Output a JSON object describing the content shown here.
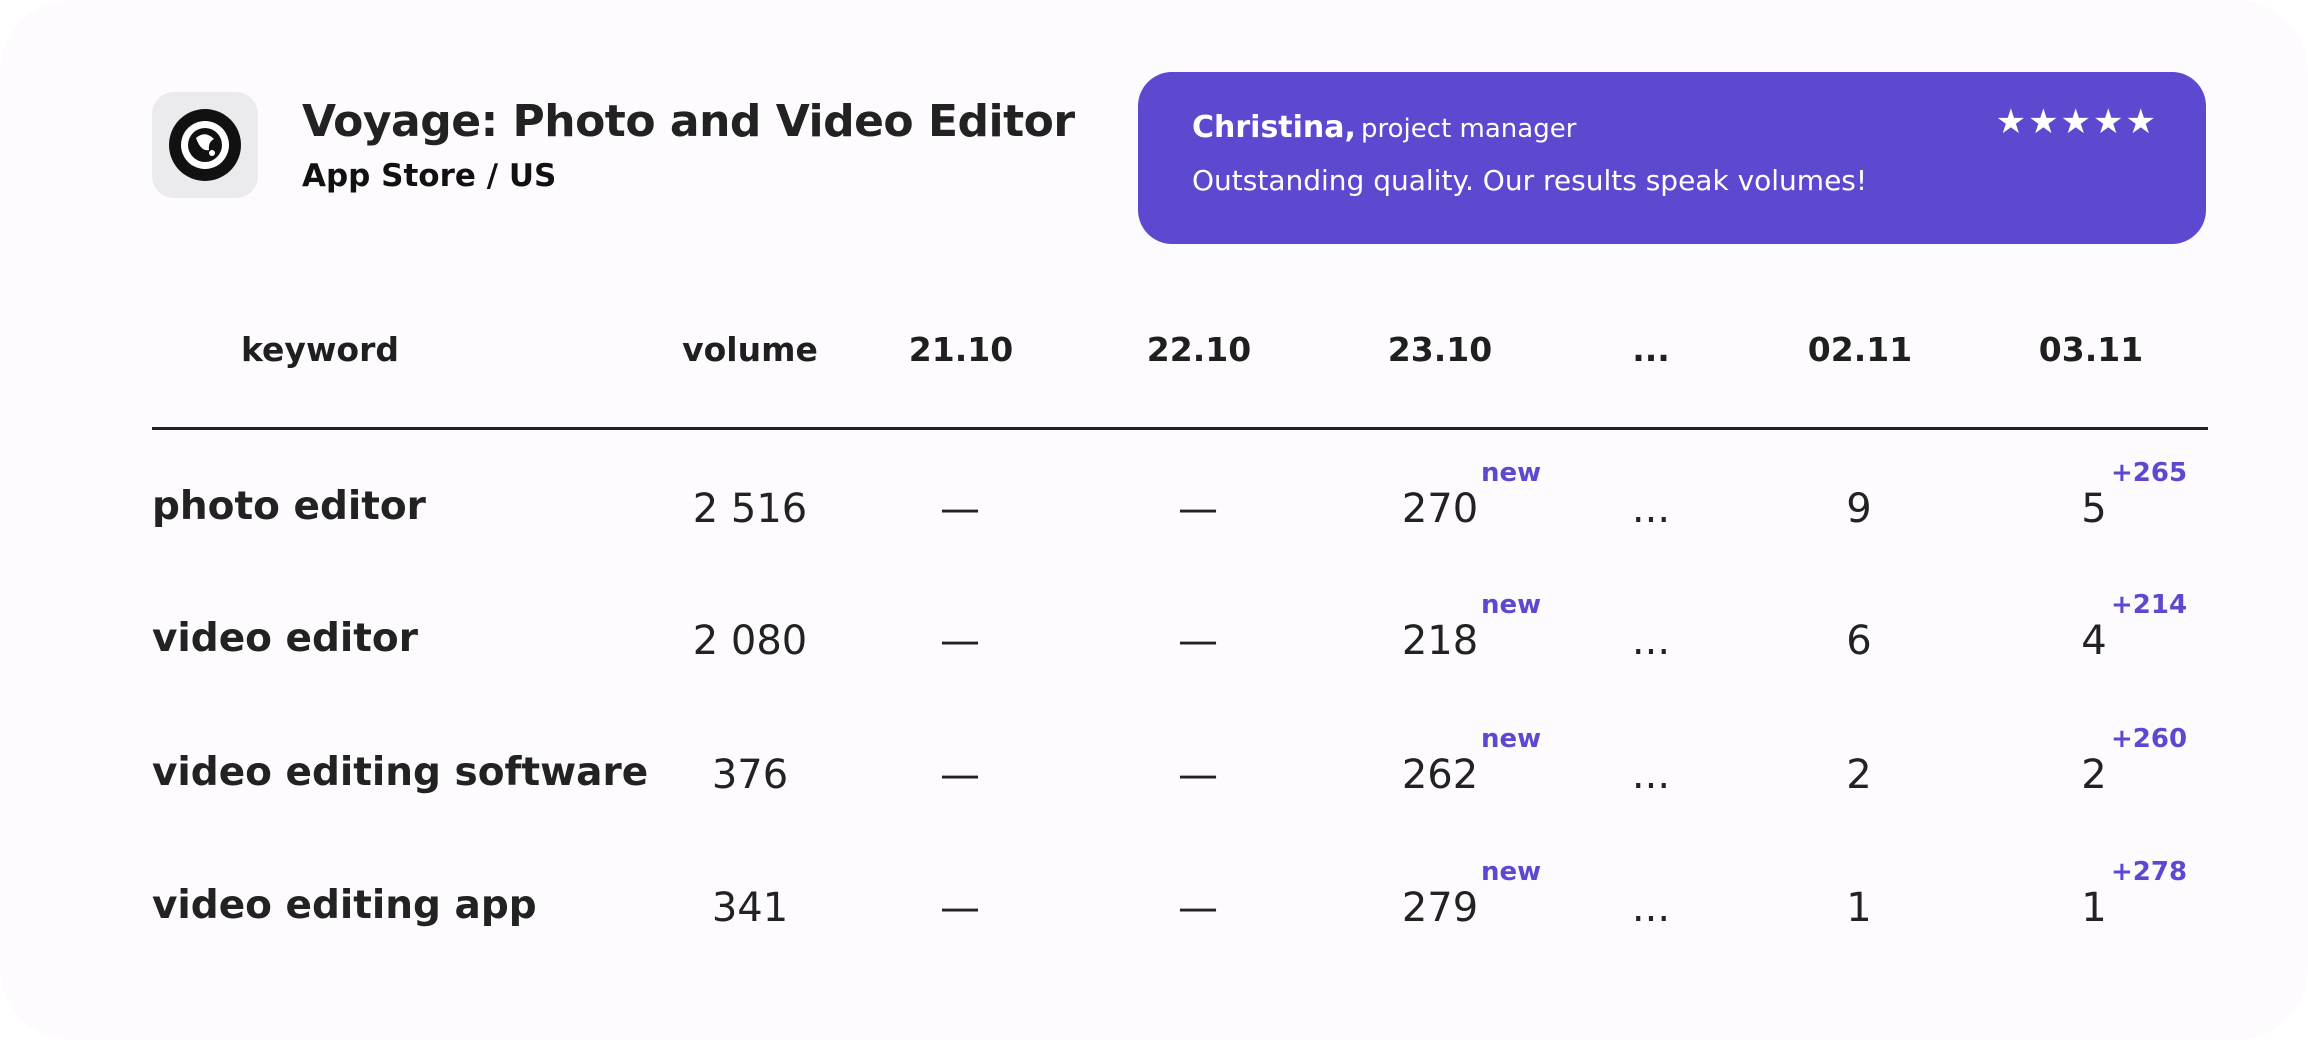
{
  "header": {
    "app_title": "Voyage: Photo and Video Editor",
    "store": "App Store / US"
  },
  "review": {
    "name": "Christina,",
    "role": "project manager",
    "stars": "★★★★★",
    "text": "Outstanding quality. Our results speak volumes!"
  },
  "table": {
    "headers": [
      "keyword",
      "volume",
      "21.10",
      "22.10",
      "23.10",
      "...",
      "02.11",
      "03.11"
    ],
    "rows": [
      {
        "keyword": "photo editor",
        "volume": "2 516",
        "d2110": "—",
        "d2210": "—",
        "d2310": "270",
        "d2310_badge": "new",
        "gap": "...",
        "d0211": "9",
        "d0311": "5",
        "d0311_delta": "+265"
      },
      {
        "keyword": "video editor",
        "volume": "2 080",
        "d2110": "—",
        "d2210": "—",
        "d2310": "218",
        "d2310_badge": "new",
        "gap": "...",
        "d0211": "6",
        "d0311": "4",
        "d0311_delta": "+214"
      },
      {
        "keyword": "video editing software",
        "volume": "376",
        "d2110": "—",
        "d2210": "—",
        "d2310": "262",
        "d2310_badge": "new",
        "gap": "...",
        "d0211": "2",
        "d0311": "2",
        "d0311_delta": "+260"
      },
      {
        "keyword": "video editing app",
        "volume": "341",
        "d2110": "—",
        "d2210": "—",
        "d2310": "279",
        "d2310_badge": "new",
        "gap": "...",
        "d0211": "1",
        "d0311": "1",
        "d0311_delta": "+278"
      }
    ]
  },
  "colors": {
    "accent": "#5d48d0",
    "text": "#222222",
    "card_background": "#fdfbfe"
  },
  "icons": {
    "app_logo": "voyage-app-logo-icon",
    "rating": "star-icon"
  }
}
